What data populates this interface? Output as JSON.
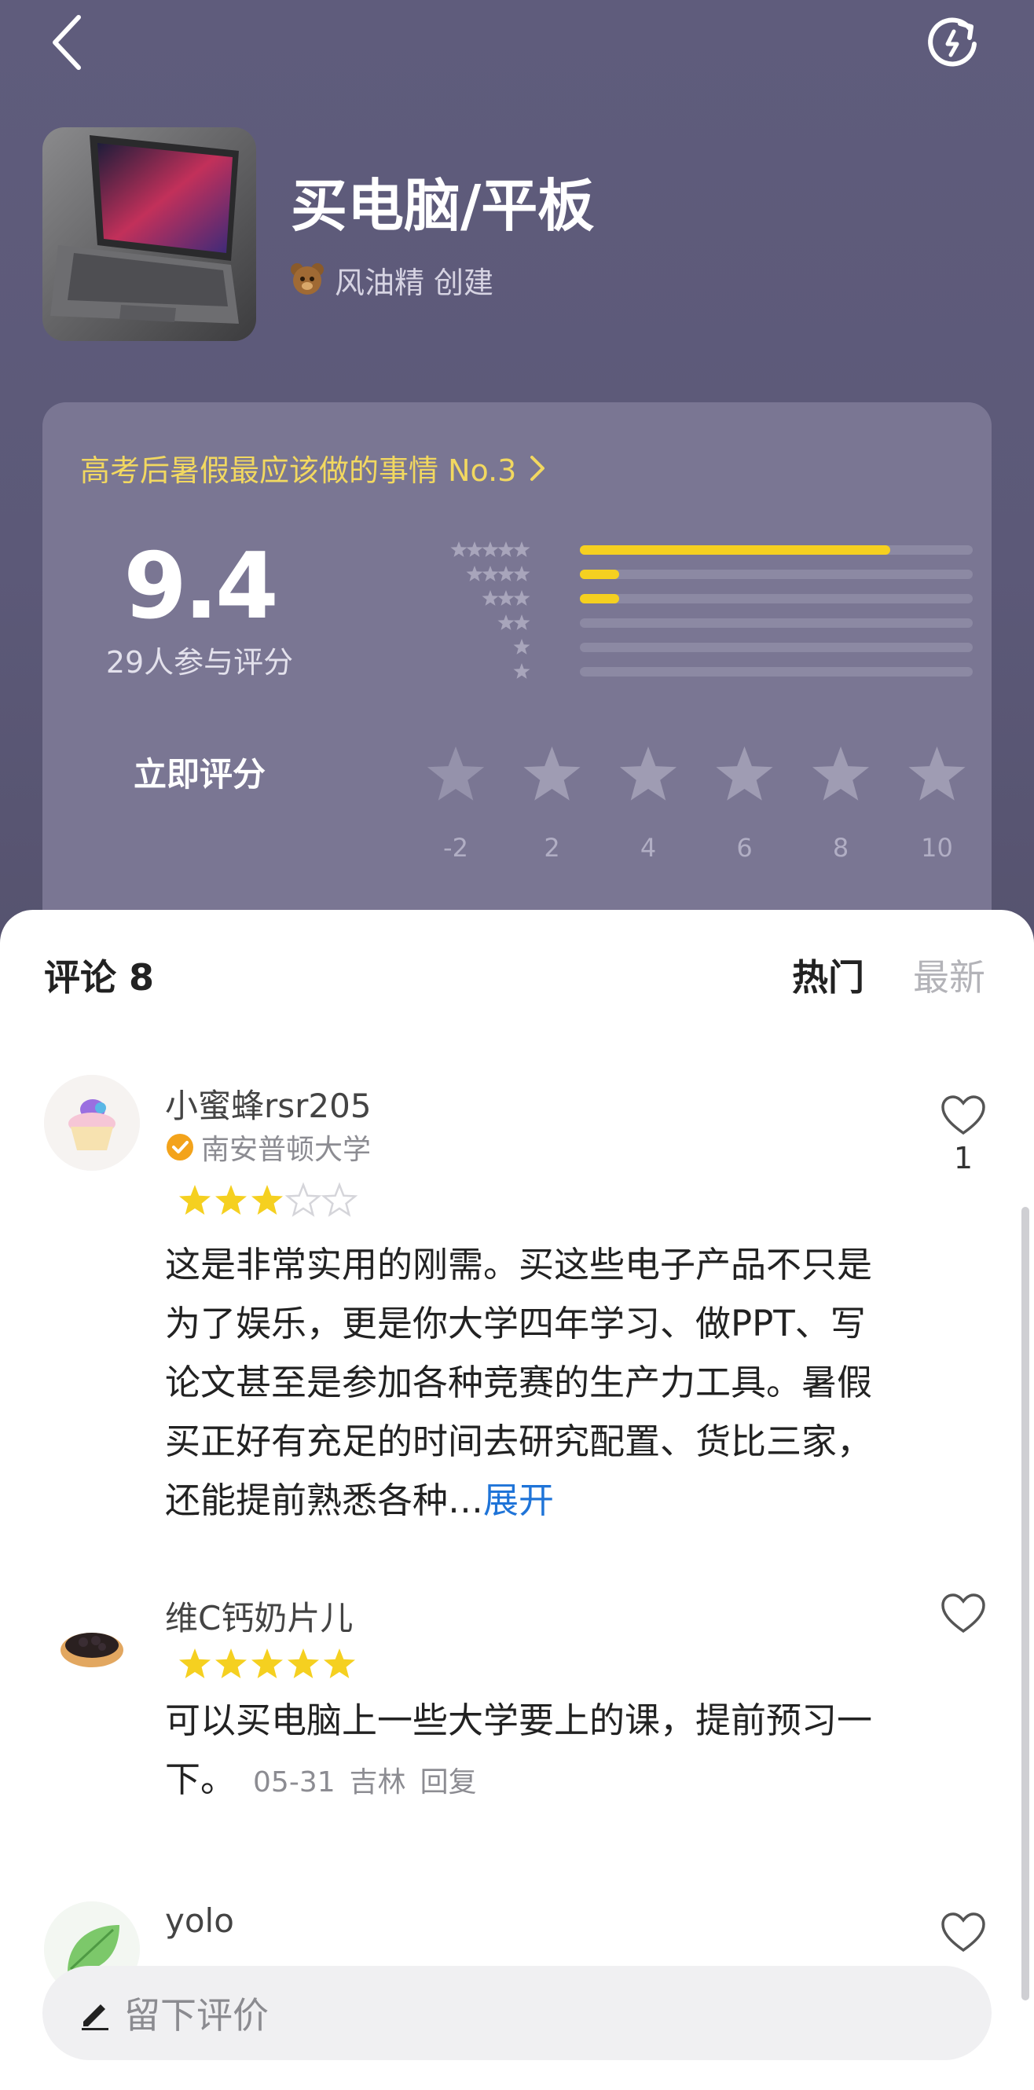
{
  "header": {
    "back_icon": "chevron-left-icon",
    "refresh_icon": "refresh-icon"
  },
  "list": {
    "title": "买电脑/平板",
    "creator_name": "风油精",
    "creator_suffix": "创建",
    "cover_icon": "laptop-image"
  },
  "score_card": {
    "rank_text": "高考后暑假最应该做的事情 No.3",
    "score": "9.4",
    "rater_count": "29人参与评分",
    "rate_now_label": "立即评分",
    "distribution": [
      {
        "stars": 5,
        "fraction": 0.79
      },
      {
        "stars": 4,
        "fraction": 0.1
      },
      {
        "stars": 3,
        "fraction": 0.1
      },
      {
        "stars": 2,
        "fraction": 0
      },
      {
        "stars": 1,
        "fraction": 0
      },
      {
        "stars": 0.5,
        "fraction": 0
      }
    ],
    "score_options": [
      "-2",
      "2",
      "4",
      "6",
      "8",
      "10"
    ],
    "accent_color": "#f5d020"
  },
  "comments_section": {
    "title": "评论 8",
    "tab_hot": "热门",
    "tab_new": "最新",
    "comments": [
      {
        "user": "小蜜蜂rsr205",
        "school": "南安普顿大学",
        "rating": 3,
        "text": "这是非常实用的刚需。买这些电子产品不只是为了娱乐，更是你大学四年学习、做PPT、写论文甚至是参加各种竞赛的生产力工具。暑假买正好有充足的时间去研究配置、货比三家，还能提前熟悉各种…",
        "expand_label": "展开",
        "likes": "1",
        "avatar_icon": "cupcake-avatar"
      },
      {
        "user": "维C钙奶片儿",
        "rating": 5,
        "text": "可以买电脑上一些大学要上的课，提前预习一下。",
        "date": "05-31",
        "location": "吉林",
        "reply_label": "回复",
        "avatar_icon": "tart-avatar"
      },
      {
        "user": "yolo",
        "avatar_icon": "leaf-avatar"
      }
    ]
  },
  "input": {
    "placeholder": "留下评价",
    "icon": "pencil-icon"
  }
}
